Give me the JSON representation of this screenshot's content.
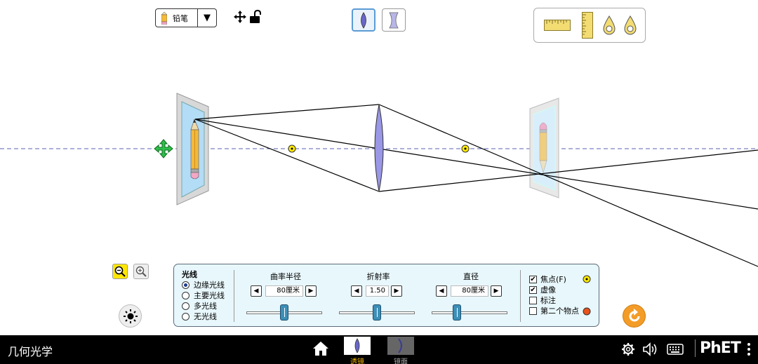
{
  "app": {
    "title": "几何光学",
    "brand": "PhET"
  },
  "toolbar": {
    "object_type": "铅笔",
    "move_icon": "move-arrows-icon",
    "lock_icon": "unlocked-padlock-icon",
    "lens_types": [
      {
        "name": "convex",
        "selected": true
      },
      {
        "name": "concave",
        "selected": false
      }
    ]
  },
  "toolbox": {
    "tools": [
      "horizontal-ruler-icon",
      "vertical-ruler-icon",
      "light-probe-icon",
      "light-probe-icon"
    ]
  },
  "scene": {
    "accent_color": "#5b9bd5",
    "focal_point_color": "#ffea00",
    "lens_color": "#9a97e6",
    "optical_axis_color": "#5b5fb5"
  },
  "panel": {
    "rays_title": "光线",
    "ray_options": [
      {
        "label": "边缘光线",
        "selected": true
      },
      {
        "label": "主要光线",
        "selected": false
      },
      {
        "label": "多光线",
        "selected": false
      },
      {
        "label": "无光线",
        "selected": false
      }
    ],
    "controls": [
      {
        "title": "曲率半径",
        "value": "80厘米",
        "level": 0.5
      },
      {
        "title": "折射率",
        "value": "1.50",
        "level": 0.5
      },
      {
        "title": "直径",
        "value": "80厘米",
        "level": 0.33
      }
    ],
    "checkboxes": [
      {
        "label": "焦点(F)",
        "checked": true
      },
      {
        "label": "虚像",
        "checked": true
      },
      {
        "label": "标注",
        "checked": false
      },
      {
        "label": "第二个物点",
        "checked": false
      }
    ],
    "second_point_color": "#e8531b"
  },
  "navbar": {
    "screens": [
      {
        "label": "透镜",
        "active": true
      },
      {
        "label": "镜面",
        "active": false
      }
    ],
    "active_color": "#f2b400"
  }
}
